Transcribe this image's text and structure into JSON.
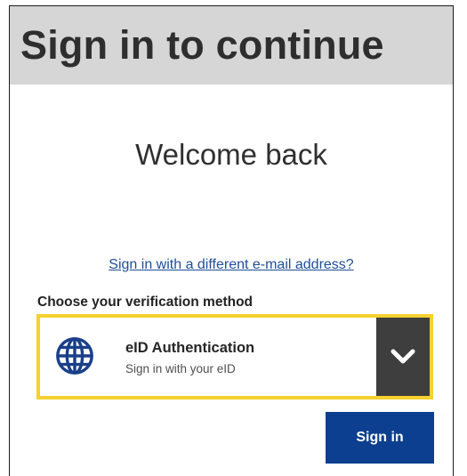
{
  "header": {
    "title": "Sign in to continue"
  },
  "welcome": {
    "text": "Welcome back"
  },
  "links": {
    "different_email": "Sign in with a different e-mail address?"
  },
  "verification": {
    "label": "Choose your verification method",
    "selected": {
      "icon": "globe-icon",
      "name": "eID Authentication",
      "description": "Sign in with your eID"
    },
    "dropdown_icon": "chevron-down-icon"
  },
  "actions": {
    "sign_in_label": "Sign in"
  },
  "colors": {
    "header_bg": "#d6d6d6",
    "link": "#1f4e96",
    "focus_border": "#f5d22e",
    "dropdown_bg": "#3e3e3e",
    "primary_button": "#0c3f8f",
    "globe": "#1a3f8a"
  }
}
